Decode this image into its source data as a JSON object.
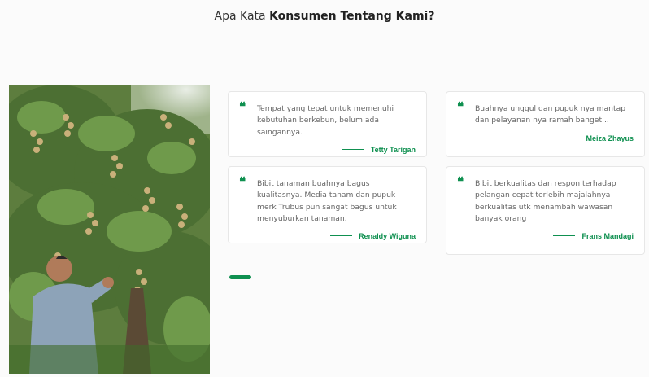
{
  "heading": {
    "prefix": "Apa Kata",
    "bold": "Konsumen Tentang Kami?"
  },
  "photo": {
    "description_icon": "longan-tree-photo"
  },
  "testimonials": [
    {
      "text": "Tempat yang tepat untuk memenuhi kebutuhan berkebun, belum ada saingannya.",
      "author": "Tetty Tarigan"
    },
    {
      "text": "Buahnya unggul dan pupuk nya mantap dan pelayanan nya ramah banget...",
      "author": "Meiza Zhayus"
    },
    {
      "text": "Bibit tanaman buahnya bagus kualitasnya. Media tanam dan pupuk merk Trubus pun sangat bagus untuk menyuburkan tanaman.",
      "author": "Renaldy Wiguna"
    },
    {
      "text": "Bibit berkualitas dan respon terhadap pelangan cepat terlebih majalahnya berkualitas utk menambah wawasan banyak orang",
      "author": "Frans Mandagi"
    }
  ],
  "colors": {
    "accent": "#0f9050",
    "background": "#fbfbfb",
    "card_border": "#e7e7e7"
  },
  "quote_glyph": "❝"
}
